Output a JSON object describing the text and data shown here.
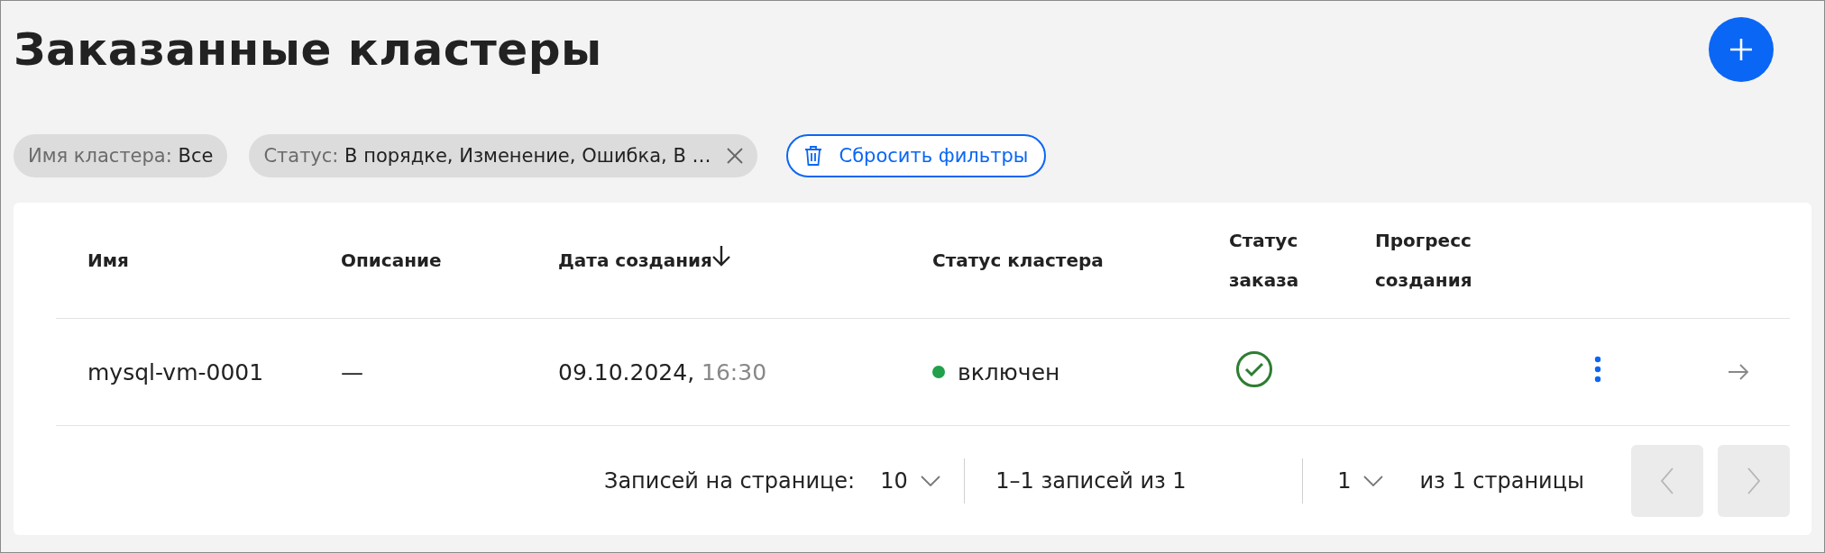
{
  "page": {
    "title": "Заказанные кластеры"
  },
  "filters": [
    {
      "label": "Имя кластера:",
      "value": "Все",
      "removable": false
    },
    {
      "label": "Статус:",
      "value": "В порядке, Изменение, Ошибка, В …",
      "removable": true
    }
  ],
  "reset_button": {
    "label": "Сбросить фильтры"
  },
  "table": {
    "columns": [
      {
        "label": "Имя",
        "sorted": false
      },
      {
        "label": "Описание",
        "sorted": false
      },
      {
        "label": "Дата создания",
        "sorted": true
      },
      {
        "label": "Статус кластера",
        "sorted": false
      },
      {
        "label": "Статус заказа",
        "sorted": false
      },
      {
        "label": "Прогресс создания",
        "sorted": false
      }
    ],
    "rows": [
      {
        "name": "mysql-vm-0001",
        "description": "—",
        "date": "09.10.2024,",
        "time": "16:30",
        "cluster_status": {
          "label": "включен",
          "color": "#22a04b"
        },
        "order_status": {
          "kind": "success"
        }
      }
    ]
  },
  "pagination": {
    "per_page_label": "Записей на странице:",
    "per_page": "10",
    "range": "1–1 записей из 1",
    "page": "1",
    "pages_label": "из 1 страницы",
    "prev_disabled": true,
    "next_disabled": true
  }
}
